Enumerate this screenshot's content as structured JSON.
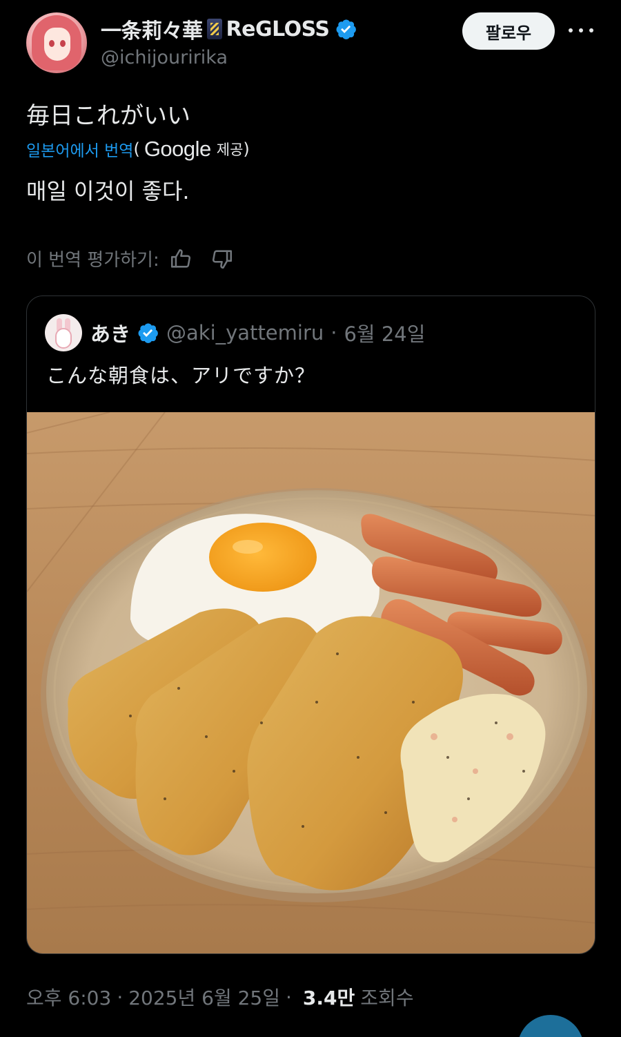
{
  "author": {
    "display_name": "一条莉々華",
    "brand_name": "ReGLOSS",
    "handle": "@ichijouririka",
    "follow_label": "팔로우"
  },
  "tweet": {
    "text": "毎日これがいい",
    "translate_link": "일본어에서 번역",
    "translate_paren_open": "(",
    "translate_provider": "Google",
    "translate_provided": "제공",
    "translate_paren_close": ")",
    "translated_text": "매일 이것이 좋다.",
    "rate_label": "이 번역 평가하기:"
  },
  "quote": {
    "name": "あき",
    "handle": "@aki_yattemiru",
    "separator": "·",
    "date": "6월 24일",
    "text": "こんな朝食は、アリですか？"
  },
  "meta": {
    "time": "오후 6:03",
    "separator1": "·",
    "date": "2025년 6월 25일",
    "separator2": "·",
    "views_count": "3.4만",
    "views_label": "조회수"
  },
  "colors": {
    "accent": "#1d9bf0",
    "muted": "#71767b",
    "text": "#e7e9ea",
    "background": "#000000"
  },
  "icons": [
    "verified-badge-icon",
    "more-icon",
    "thumbs-up-icon",
    "thumbs-down-icon",
    "flag-emoji-icon"
  ]
}
